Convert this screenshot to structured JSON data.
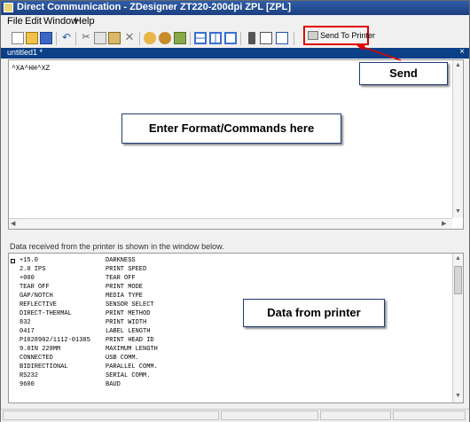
{
  "window": {
    "title": "Direct Communication - ZDesigner ZT220-200dpi ZPL [ZPL]",
    "menu": [
      "File",
      "Edit",
      "Window",
      "Help"
    ],
    "toolbar": {
      "send_label": "Send To Printer",
      "icons": [
        "new-icon",
        "open-icon",
        "save-icon",
        "undo-icon",
        "cut-icon",
        "copy-icon",
        "paste-icon",
        "delete-icon",
        "find-icon",
        "find-next-icon",
        "replace-icon",
        "layout-horizontal-icon",
        "layout-vertical-icon",
        "layout-single-icon",
        "trash-icon",
        "open-file-icon",
        "save-file-icon",
        "send-to-printer-icon"
      ]
    },
    "tab": {
      "label": "untitled1 *",
      "close": "×"
    },
    "editor": {
      "content": "^XA^HH^XZ"
    },
    "info_label": "Data received from the printer is shown in the window below.",
    "printer_data": [
      {
        "value": "+15.0",
        "name": "DARKNESS"
      },
      {
        "value": "2.0 IPS",
        "name": "PRINT SPEED"
      },
      {
        "value": "+000",
        "name": "TEAR OFF"
      },
      {
        "value": "TEAR OFF",
        "name": "PRINT MODE"
      },
      {
        "value": "GAP/NOTCH",
        "name": "MEDIA TYPE"
      },
      {
        "value": "REFLECTIVE",
        "name": "SENSOR SELECT"
      },
      {
        "value": "DIRECT-THERMAL",
        "name": "PRINT METHOD"
      },
      {
        "value": "832",
        "name": "PRINT WIDTH"
      },
      {
        "value": "0417",
        "name": "LABEL LENGTH"
      },
      {
        "value": "P1028902/1112-01385",
        "name": "PRINT HEAD ID"
      },
      {
        "value": "9.0IN      228MM",
        "name": "MAXIMUM LENGTH"
      },
      {
        "value": "CONNECTED",
        "name": "USB COMM."
      },
      {
        "value": "BIDIRECTIONAL",
        "name": "PARALLEL COMM."
      },
      {
        "value": "RS232",
        "name": "SERIAL COMM."
      },
      {
        "value": "9600",
        "name": "BAUD"
      }
    ]
  },
  "callouts": {
    "send": "Send",
    "enter_format": "Enter Format/Commands here",
    "data_from_printer": "Data from printer"
  },
  "colors": {
    "title_bar": "#1c3f80",
    "tab_bar": "#0b3f86",
    "highlight": "#e00000"
  }
}
